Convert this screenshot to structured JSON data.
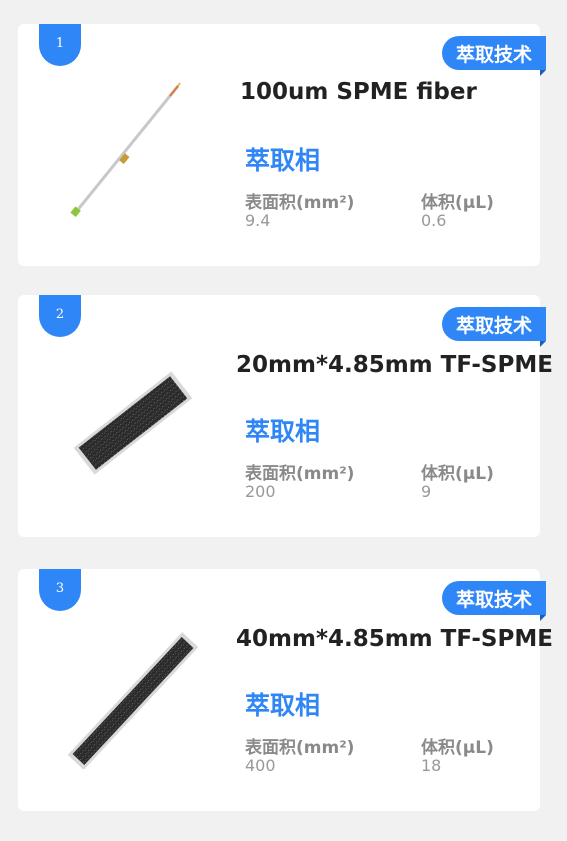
{
  "cards": [
    {
      "number": "1",
      "tag": "萃取技术",
      "title": "100um SPME fiber",
      "phase": "萃取相",
      "area_label": "表面积(mm²)",
      "area_value": "9.4",
      "volume_label": "体积(μL)",
      "volume_value": "0.6",
      "image": "spme-fiber-image"
    },
    {
      "number": "2",
      "tag": "萃取技术",
      "title": "20mm*4.85mm TF-SPME",
      "phase": "萃取相",
      "area_label": "表面积(mm²)",
      "area_value": "200",
      "volume_label": "体积(μL)",
      "volume_value": "9",
      "image": "tf-spme-strip-image"
    },
    {
      "number": "3",
      "tag": "萃取技术",
      "title": "40mm*4.85mm TF-SPME",
      "phase": "萃取相",
      "area_label": "表面积(mm²)",
      "area_value": "400",
      "volume_label": "体积(μL)",
      "volume_value": "18",
      "image": "tf-spme-strip-image"
    }
  ],
  "colors": {
    "accent": "#2f86f6",
    "background": "#f1f1f1",
    "card": "#ffffff"
  }
}
